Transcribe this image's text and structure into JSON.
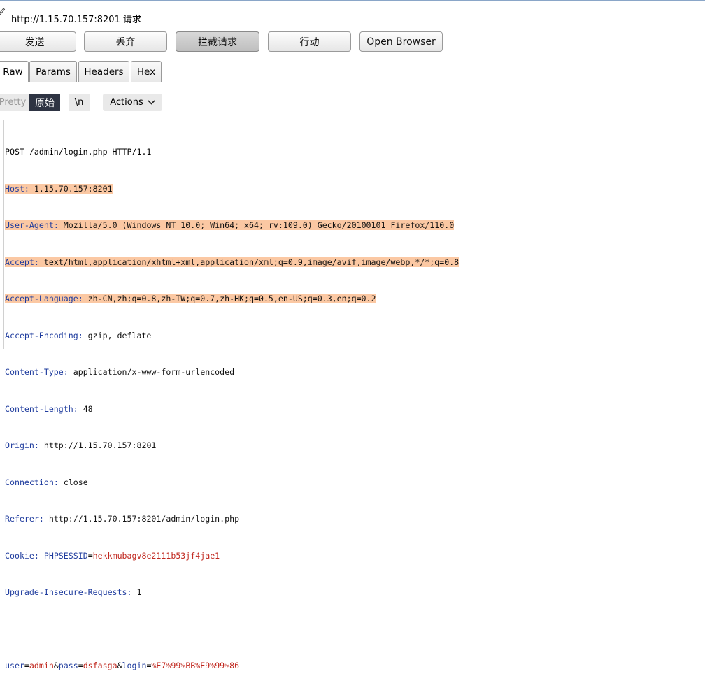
{
  "header": {
    "url_title": "http://1.15.70.157:8201 请求"
  },
  "buttons": {
    "send": "发送",
    "discard": "丢弃",
    "intercept": "拦截请求",
    "action": "行动",
    "open_browser": "Open Browser"
  },
  "tabs": [
    "Raw",
    "Params",
    "Headers",
    "Hex"
  ],
  "view_toolbar": {
    "pretty": "Pretty",
    "raw": "原始",
    "newline": "\\n",
    "actions": "Actions"
  },
  "request": {
    "request_line": "POST /admin/login.php HTTP/1.1",
    "headers": [
      {
        "name": "Host",
        "value": "1.15.70.157:8201"
      },
      {
        "name": "User-Agent",
        "value": "Mozilla/5.0 (Windows NT 10.0; Win64; x64; rv:109.0) Gecko/20100101 Firefox/110.0"
      },
      {
        "name": "Accept",
        "value": "text/html,application/xhtml+xml,application/xml;q=0.9,image/avif,image/webp,*/*;q=0.8"
      },
      {
        "name": "Accept-Language",
        "value": "zh-CN,zh;q=0.8,zh-TW;q=0.7,zh-HK;q=0.5,en-US;q=0.3,en;q=0.2"
      },
      {
        "name": "Accept-Encoding",
        "value": "gzip, deflate"
      },
      {
        "name": "Content-Type",
        "value": "application/x-www-form-urlencoded"
      },
      {
        "name": "Content-Length",
        "value": "48"
      },
      {
        "name": "Origin",
        "value": "http://1.15.70.157:8201"
      },
      {
        "name": "Connection",
        "value": "close"
      },
      {
        "name": "Referer",
        "value": "http://1.15.70.157:8201/admin/login.php"
      }
    ],
    "cookie": {
      "name": "Cookie",
      "param": "PHPSESSID",
      "value": "hekkmubagv8e2111b53jf4jae1"
    },
    "last_header": {
      "name": "Upgrade-Insecure-Requests",
      "value": "1"
    },
    "body": [
      {
        "key": "user",
        "value": "admin"
      },
      {
        "key": "pass",
        "value": "dsfasga"
      },
      {
        "key": "login",
        "value": "%E7%99%BB%E9%99%86"
      }
    ]
  },
  "colors": {
    "header_name": "#1f3c9e",
    "param_value": "#c0271e",
    "highlight": "#fbc8a3",
    "active_view": "#2e3443"
  }
}
